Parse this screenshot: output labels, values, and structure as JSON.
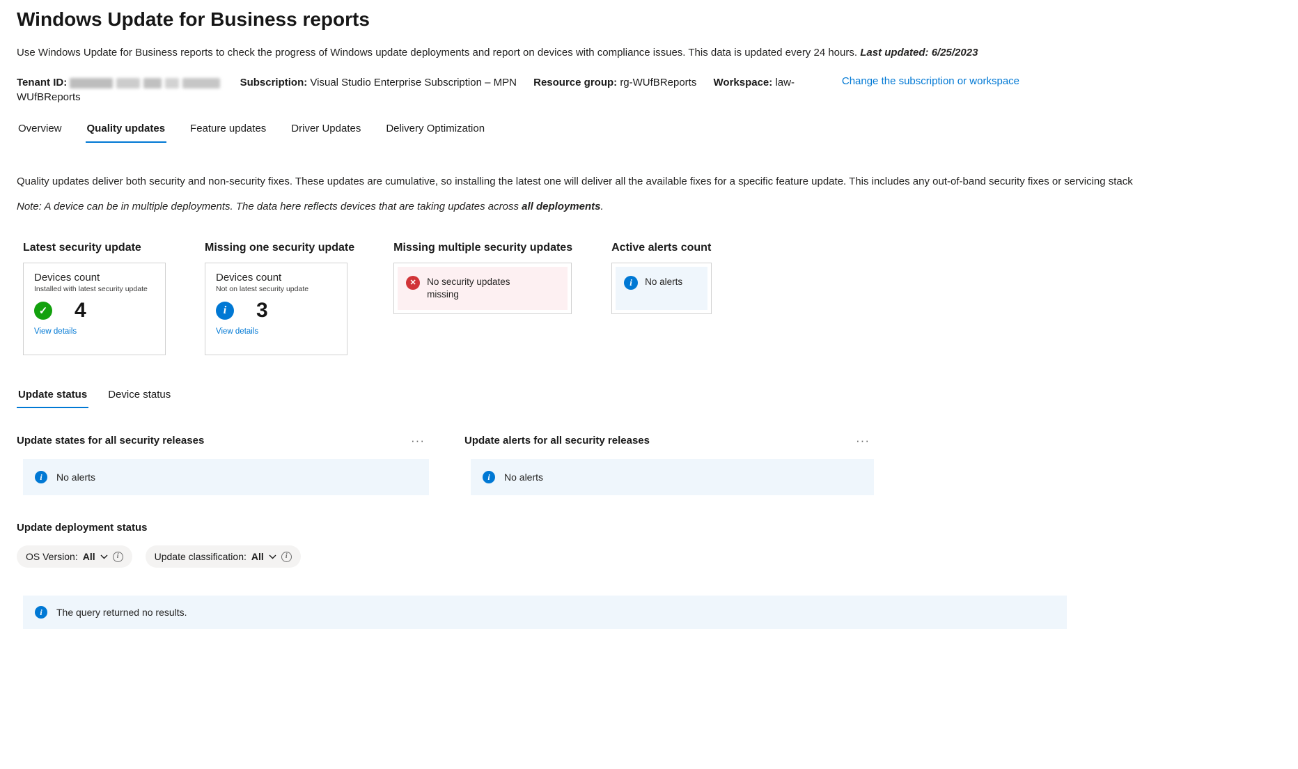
{
  "header": {
    "title": "Windows Update for Business reports",
    "description": "Use Windows Update for Business reports to check the progress of Windows update deployments and report on devices with compliance issues. This data is updated every 24 hours. ",
    "last_updated": "Last updated: 6/25/2023"
  },
  "meta": {
    "tenant_label": "Tenant ID: ",
    "subscription_label": "Subscription: ",
    "subscription_value": "Visual Studio Enterprise Subscription – MPN",
    "resource_group_label": "Resource group: ",
    "resource_group_value": "rg-WUfBReports",
    "workspace_label": "Workspace: ",
    "workspace_value": "law-WUfBReports",
    "change_link": "Change the subscription or workspace"
  },
  "tabs": {
    "items": [
      {
        "label": "Overview",
        "active": false
      },
      {
        "label": "Quality updates",
        "active": true
      },
      {
        "label": "Feature updates",
        "active": false
      },
      {
        "label": "Driver Updates",
        "active": false
      },
      {
        "label": "Delivery Optimization",
        "active": false
      }
    ]
  },
  "intro": {
    "paragraph": "Quality updates deliver both security and non-security fixes. These updates are cumulative, so installing the latest one will deliver all the available fixes for a specific feature update. This includes any out-of-band security fixes or servicing stack",
    "note_prefix": "Note: A device can be in multiple deployments. The data here reflects devices that are taking updates across ",
    "note_bold": "all deployments",
    "note_suffix": "."
  },
  "cards": {
    "latest": {
      "title": "Latest security update",
      "metric_label": "Devices count",
      "metric_sub": "Installed with latest security update",
      "value": "4",
      "link": "View details"
    },
    "missing_one": {
      "title": "Missing one security update",
      "metric_label": "Devices count",
      "metric_sub": "Not on latest security update",
      "value": "3",
      "link": "View details"
    },
    "missing_multiple": {
      "title": "Missing multiple security updates",
      "alert_text": "No security updates missing"
    },
    "active_alerts": {
      "title": "Active alerts count",
      "alert_text": "No alerts"
    }
  },
  "sub_tabs": {
    "items": [
      {
        "label": "Update status",
        "active": true
      },
      {
        "label": "Device status",
        "active": false
      }
    ]
  },
  "sections": {
    "left": {
      "title": "Update states for all security releases",
      "alert_text": "No alerts"
    },
    "right": {
      "title": "Update alerts for all security releases",
      "alert_text": "No alerts"
    }
  },
  "deployment": {
    "title": "Update deployment status",
    "filters": [
      {
        "label": "OS Version: ",
        "value": "All"
      },
      {
        "label": "Update classification: ",
        "value": "All"
      }
    ],
    "empty_message": "The query returned no results."
  },
  "icons": {
    "check": "✓",
    "info": "i",
    "error": "✕",
    "more": "···"
  },
  "colors": {
    "accent": "#0078d4",
    "success": "#13a10e",
    "error": "#d13438",
    "error_bg": "#fdf0f2",
    "info_bg": "#eff6fc"
  }
}
